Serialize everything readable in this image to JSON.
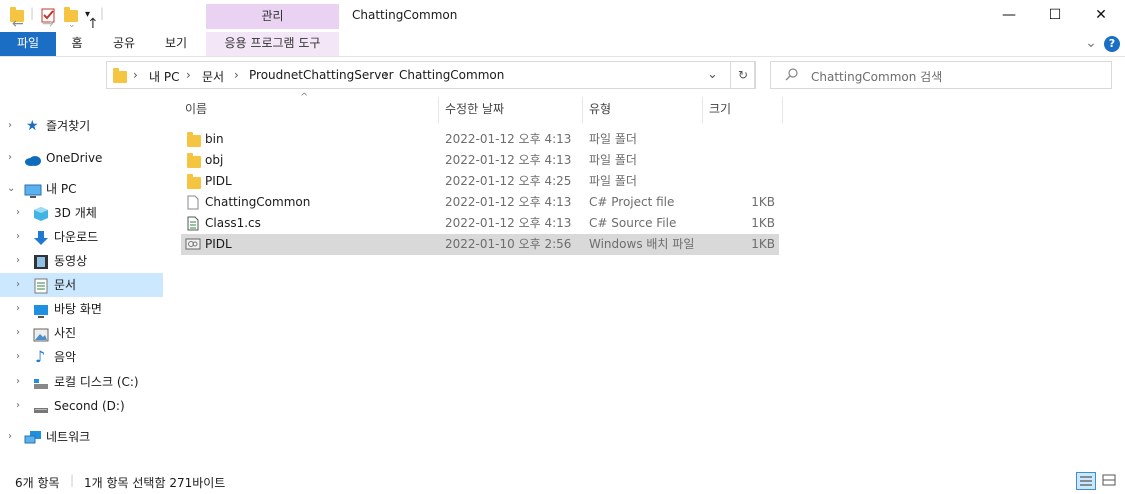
{
  "titlebar": {
    "manage_label": "관리",
    "title": "ChattingCommon",
    "minimize": "—",
    "maximize": "☐",
    "close": "✕"
  },
  "ribbon": {
    "tabs": [
      "파일",
      "홈",
      "공유",
      "보기",
      "응용 프로그램 도구"
    ],
    "expand_glyph": "⌄",
    "help_glyph": "?"
  },
  "address": {
    "crumbs": [
      "내 PC",
      "문서",
      "ProudnetChattingServer",
      "ChattingCommon"
    ],
    "sep": "›",
    "search_placeholder": "ChattingCommon 검색"
  },
  "sidebar": {
    "items": [
      {
        "label": "즐겨찾기",
        "icon": "star-icon"
      },
      {
        "label": "OneDrive",
        "icon": "cloud-icon"
      },
      {
        "label": "내 PC",
        "icon": "pc-icon"
      },
      {
        "label": "3D 개체",
        "icon": "cube-icon"
      },
      {
        "label": "다운로드",
        "icon": "download-arrow-icon"
      },
      {
        "label": "동영상",
        "icon": "film-icon"
      },
      {
        "label": "문서",
        "icon": "document-icon"
      },
      {
        "label": "바탕 화면",
        "icon": "desktop-icon"
      },
      {
        "label": "사진",
        "icon": "picture-icon"
      },
      {
        "label": "음악",
        "icon": "music-note-icon"
      },
      {
        "label": "로컬 디스크 (C:)",
        "icon": "drive-c-icon"
      },
      {
        "label": "Second (D:)",
        "icon": "drive-d-icon"
      },
      {
        "label": "네트워크",
        "icon": "network-icon"
      }
    ]
  },
  "columns": {
    "name": "이름",
    "date": "수정한 날짜",
    "type": "유형",
    "size": "크기"
  },
  "files": [
    {
      "name": "bin",
      "date": "2022-01-12 오후 4:13",
      "type": "파일 폴더",
      "size": "",
      "icon": "folder-icon"
    },
    {
      "name": "obj",
      "date": "2022-01-12 오후 4:13",
      "type": "파일 폴더",
      "size": "",
      "icon": "folder-icon"
    },
    {
      "name": "PIDL",
      "date": "2022-01-12 오후 4:25",
      "type": "파일 폴더",
      "size": "",
      "icon": "folder-icon"
    },
    {
      "name": "ChattingCommon",
      "date": "2022-01-12 오후 4:13",
      "type": "C# Project file",
      "size": "1KB",
      "icon": "blank-file-icon"
    },
    {
      "name": "Class1.cs",
      "date": "2022-01-12 오후 4:13",
      "type": "C# Source File",
      "size": "1KB",
      "icon": "cs-file-icon"
    },
    {
      "name": "PIDL",
      "date": "2022-01-10 오후 2:56",
      "type": "Windows 배치 파일",
      "size": "1KB",
      "icon": "batch-file-icon"
    }
  ],
  "status": {
    "count": "6개 항목",
    "selection": "1개 항목 선택함 271바이트"
  },
  "colors": {
    "accent": "#1a6fc5",
    "manage_tab": "#e9d2f2",
    "selected_nav": "#cce8ff",
    "selected_row": "#d9d9d9",
    "folder": "#f5c542"
  }
}
